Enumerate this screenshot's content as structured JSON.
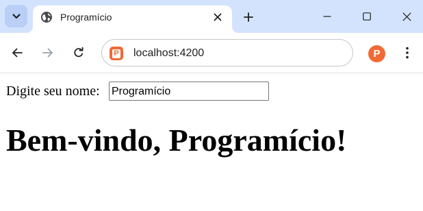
{
  "browser": {
    "tab": {
      "title": "Programício",
      "favicon": "globe-icon",
      "close_icon": "close-icon"
    },
    "tab_search_icon": "chevron-down-icon",
    "new_tab_icon": "plus-icon",
    "window_controls": [
      "minimize-icon",
      "maximize-icon",
      "close-icon"
    ],
    "toolbar": {
      "back_icon": "arrow-left-icon",
      "forward_icon": "arrow-right-icon",
      "reload_icon": "reload-icon",
      "url": "localhost:4200",
      "site_icon_letter": "P",
      "extension_icon_letter": "P",
      "menu_icon": "kebab-menu-icon"
    },
    "colors": {
      "tabstrip": "#d3e3fd",
      "accent": "#f06a35"
    }
  },
  "page": {
    "name_label": "Digite seu nome:",
    "name_input_value": "Programício",
    "greeting": "Bem-vindo, Programício!"
  }
}
